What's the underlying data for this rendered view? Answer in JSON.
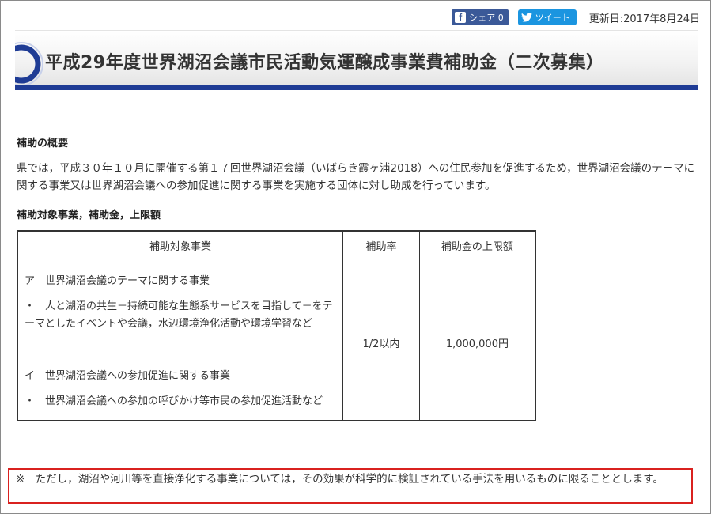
{
  "topbar": {
    "share_icon": "facebook-icon",
    "share_label": "シェア 0",
    "tweet_icon": "twitter-icon",
    "tweet_label": "ツイート",
    "updated": "更新日:2017年8月24日"
  },
  "header": {
    "title": "平成29年度世界湖沼会議市民活動気運醸成事業費補助金（二次募集）",
    "accent_color": "#1f3c95"
  },
  "section1": {
    "heading": "補助の概要",
    "body": "県では，平成３０年１０月に開催する第１７回世界湖沼会議（いばらき霞ヶ浦2018）への住民参加を促進するため，世界湖沼会議のテーマに関する事業又は世界湖沼会議への参加促進に関する事業を実施する団体に対し助成を行っています。"
  },
  "section2": {
    "heading": "補助対象事業，補助金，上限額"
  },
  "table": {
    "headers": [
      "補助対象事業",
      "補助率",
      "補助金の上限額"
    ],
    "item_a": "ア　世界湖沼会議のテーマに関する事業",
    "item_a_detail": "・　人と湖沼の共生－持続可能な生態系サービスを目指して－をテーマとしたイベントや会議，水辺環境浄化活動や環境学習など",
    "item_i": "イ　世界湖沼会議への参加促進に関する事業",
    "item_i_detail": "・　世界湖沼会議への参加の呼びかけ等市民の参加促進活動など",
    "rate": "1/2以内",
    "limit": "1,000,000円"
  },
  "note": {
    "text": "※　ただし，湖沼や河川等を直接浄化する事業については，その効果が科学的に検証されている手法を用いるものに限ることとします。",
    "border_color": "#d9211f"
  }
}
